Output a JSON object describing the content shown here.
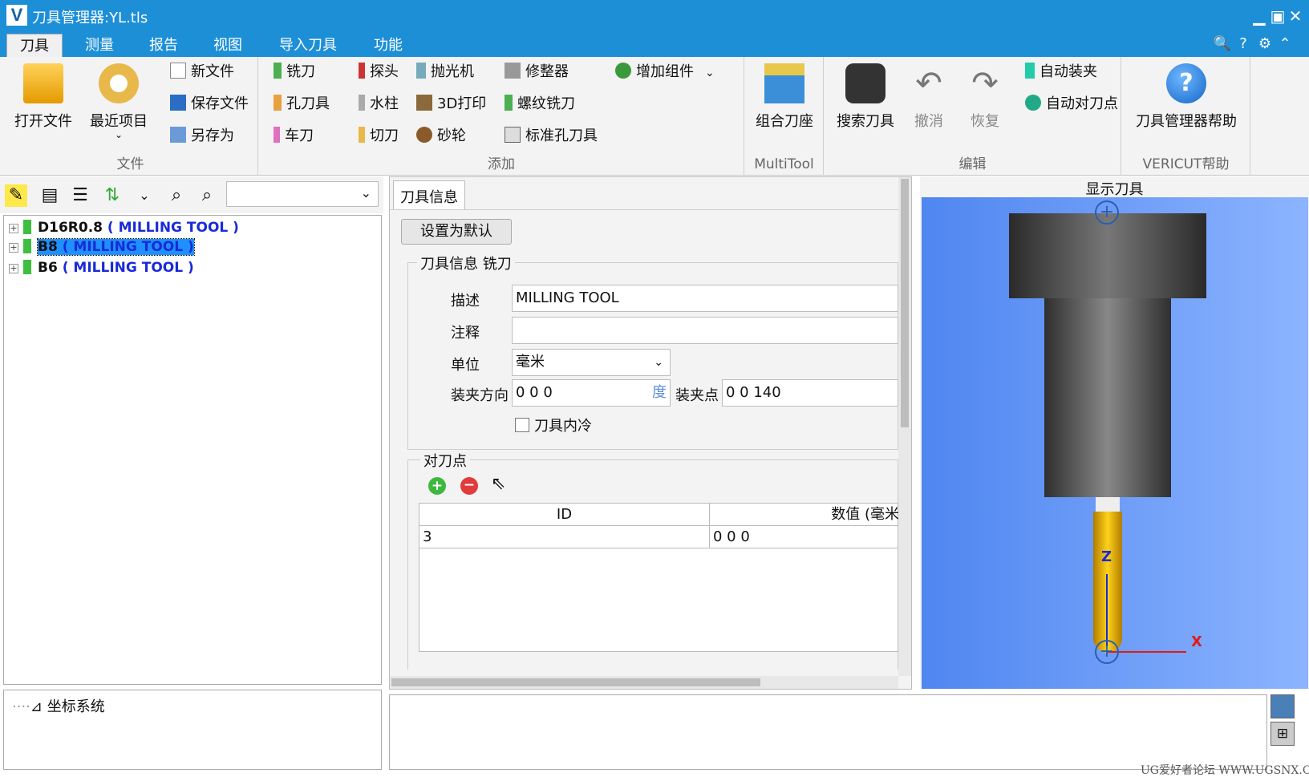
{
  "window": {
    "title": "刀具管理器:YL.tls",
    "logo": "V"
  },
  "menu_tabs": [
    "刀具",
    "测量",
    "报告",
    "视图",
    "导入刀具",
    "功能"
  ],
  "ribbon": {
    "file": {
      "label": "文件",
      "open": "打开文件",
      "recent": "最近项目",
      "new": "新文件",
      "save": "保存文件",
      "saveas": "另存为"
    },
    "add": {
      "label": "添加",
      "mill": "铣刀",
      "probe": "探头",
      "polisher": "抛光机",
      "dresser": "修整器",
      "addcomp": "增加组件",
      "hole": "孔刀具",
      "post": "水柱",
      "print3d": "3D打印",
      "thread": "螺纹铣刀",
      "lathe": "车刀",
      "cutoff": "切刀",
      "wheel": "砂轮",
      "stdhole": "标准孔刀具"
    },
    "multitool": {
      "label": "MultiTool",
      "combo": "组合刀座"
    },
    "edit": {
      "label": "编辑",
      "search": "搜索刀具",
      "undo": "撤消",
      "redo": "恢复",
      "autoclamp": "自动装夹",
      "autoref": "自动对刀点"
    },
    "help": {
      "label": "VERICUT帮助",
      "button": "刀具管理器帮助"
    }
  },
  "tree": [
    {
      "id": "D16R0.8",
      "type": "( MILLING TOOL )"
    },
    {
      "id": "B8",
      "type": "( MILLING TOOL )"
    },
    {
      "id": "B6",
      "type": "( MILLING TOOL )"
    }
  ],
  "coord": {
    "label": "坐标系统"
  },
  "info": {
    "tab": "刀具信息",
    "set_default": "设置为默认",
    "group": "刀具信息 铣刀",
    "desc_label": "描述",
    "desc": "MILLING TOOL",
    "comment_label": "注释",
    "comment": "",
    "unit_label": "单位",
    "unit": "毫米",
    "dir_label": "装夹方向",
    "dir": "0 0 0",
    "deg": "度",
    "pt_label": "装夹点",
    "pt": "0 0 140",
    "coolant": "刀具内冷",
    "ref_group": "对刀点",
    "col_id": "ID",
    "col_val": "数值 (毫米",
    "rows": [
      {
        "id": "3",
        "val": "0 0 0"
      }
    ]
  },
  "view": {
    "title": "显示刀具",
    "z": "Z",
    "x": "X"
  },
  "watermark": "UG爱好者论坛 WWW.UGSNX.COM",
  "colors": {
    "titlebar": "#1d8fd6",
    "tool_yellow": "#f5b800",
    "link_blue": "#1a2ad8",
    "selection": "#1e90ff"
  }
}
